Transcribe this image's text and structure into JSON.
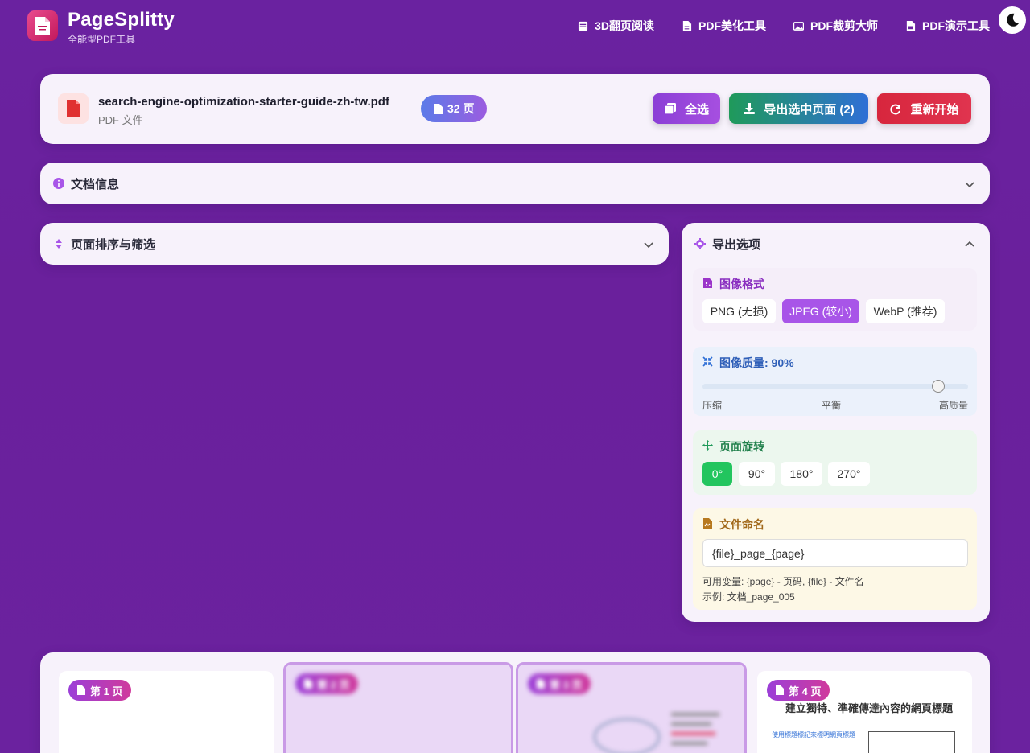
{
  "header": {
    "brand_name": "PageSplitty",
    "brand_sub": "全能型PDF工具",
    "nav": [
      {
        "label": "3D翻页阅读",
        "icon": "book-icon"
      },
      {
        "label": "PDF美化工具",
        "icon": "file-icon"
      },
      {
        "label": "PDF裁剪大师",
        "icon": "image-icon"
      },
      {
        "label": "PDF演示工具",
        "icon": "file-presentation-icon"
      }
    ],
    "theme_icon": "moon-icon"
  },
  "file": {
    "name": "search-engine-optimization-starter-guide-zh-tw.pdf",
    "type": "PDF 文件",
    "pages": "32 页"
  },
  "actions": {
    "select_all": "全选",
    "export_selected": "导出选中页面 (2)",
    "restart": "重新开始"
  },
  "panels": {
    "doc_info": "文档信息",
    "sort_filter": "页面排序与筛选",
    "export_options": "导出选项"
  },
  "export": {
    "format": {
      "label": "图像格式",
      "options": [
        "PNG (无损)",
        "JPEG (较小)",
        "WebP (推荐)"
      ],
      "selected": "JPEG (较小)"
    },
    "quality": {
      "label": "图像质量: 90%",
      "value": 90,
      "scale_labels": [
        "压缩",
        "平衡",
        "高质量"
      ]
    },
    "rotation": {
      "label": "页面旋转",
      "options": [
        "0°",
        "90°",
        "180°",
        "270°"
      ],
      "selected": "0°"
    },
    "naming": {
      "label": "文件命名",
      "value": "{file}_page_{page}",
      "hint1": "可用变量: {page} - 页码, {file} - 文件名",
      "hint2": "示例: 文档_page_005"
    }
  },
  "thumbnails": [
    {
      "label": "第 1 页",
      "selected": false
    },
    {
      "label": "第 2 页",
      "selected": true
    },
    {
      "label": "第 3 页",
      "selected": true
    },
    {
      "label": "第 4 页",
      "selected": false,
      "heading": "建立獨特、準確傳達內容的網頁標題",
      "subheading": "使用標題標記來標明網頁標題"
    }
  ],
  "colors": {
    "background": "#6a22a0",
    "accent": "#a855e8",
    "export_green": "#1f9a5a",
    "restart_red": "#d7263d"
  }
}
